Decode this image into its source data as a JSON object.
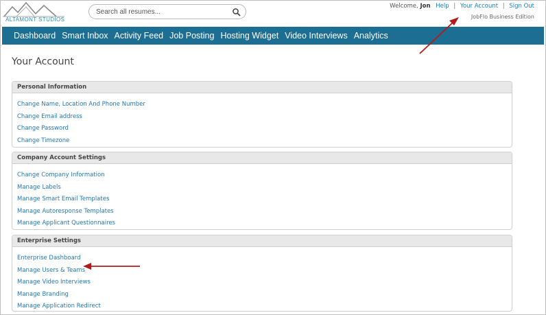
{
  "brand": {
    "logo_text": "ALTAMONT STUDIOS"
  },
  "search": {
    "placeholder": "Search all resumes..."
  },
  "top_bar": {
    "welcome_prefix": "Welcome,",
    "user_name": "Jon",
    "help": "Help",
    "your_account": "Your Account",
    "sign_out": "Sign Out",
    "separator": "|",
    "edition": "JobFlo Business Edition"
  },
  "nav": {
    "items": [
      "Dashboard",
      "Smart Inbox",
      "Activity Feed",
      "Job Posting",
      "Hosting Widget",
      "Video Interviews",
      "Analytics"
    ]
  },
  "page": {
    "title": "Your Account"
  },
  "sections": [
    {
      "title": "Personal Information",
      "links": [
        "Change Name, Location And Phone Number",
        "Change Email address",
        "Change Password",
        "Change Timezone"
      ]
    },
    {
      "title": "Company Account Settings",
      "links": [
        "Change Company Information",
        "Manage Labels",
        "Manage Smart Email Templates",
        "Manage Autoresponse Templates",
        "Manage Applicant Questionnaires"
      ]
    },
    {
      "title": "Enterprise Settings",
      "links": [
        "Enterprise Dashboard",
        "Manage Users & Teams",
        "Manage Video Interviews",
        "Manage Branding",
        "Manage Application Redirect"
      ]
    }
  ],
  "colors": {
    "nav_bg": "#1d6e93",
    "link": "#2477b5",
    "annotation_arrow": "#b01c1c"
  }
}
